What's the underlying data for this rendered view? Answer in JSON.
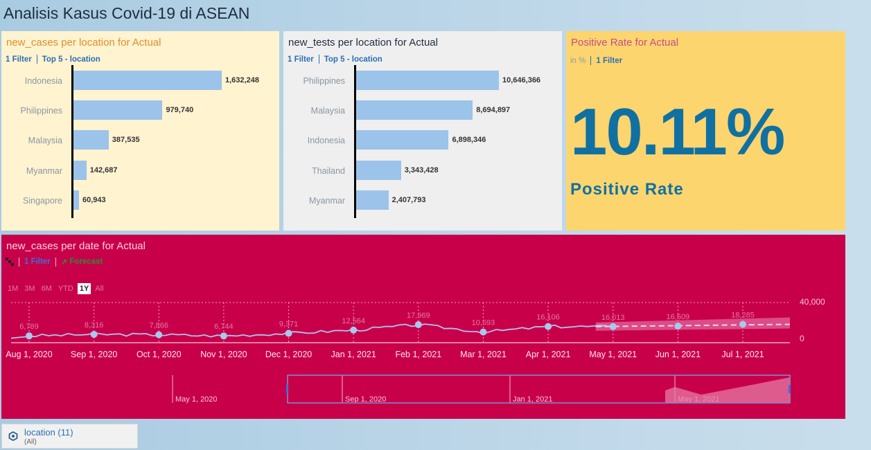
{
  "app": {
    "title": "Analisis Kasus Covid-19 di ASEAN"
  },
  "tile_cases": {
    "title": "new_cases per location for Actual",
    "filter": "1 Filter",
    "top": "Top 5 - location",
    "chart_data": {
      "type": "bar",
      "categories": [
        "Indonesia",
        "Philippines",
        "Malaysia",
        "Myanmar",
        "Singapore"
      ],
      "values": [
        1632248,
        979740,
        387535,
        142687,
        60943
      ],
      "value_labels": [
        "1,632,248",
        "979,740",
        "387,535",
        "142,687",
        "60,943"
      ]
    }
  },
  "tile_tests": {
    "title": "new_tests per location for Actual",
    "filter": "1 Filter",
    "top": "Top 5 - location",
    "chart_data": {
      "type": "bar",
      "categories": [
        "Philippines",
        "Malaysia",
        "Indonesia",
        "Thailand",
        "Myanmar"
      ],
      "values": [
        10646366,
        8694897,
        6898346,
        3343428,
        2407793
      ],
      "value_labels": [
        "10,646,366",
        "8,694,897",
        "6,898,346",
        "3,343,428",
        "2,407,793"
      ]
    }
  },
  "tile_rate": {
    "title": "Positive Rate for Actual",
    "unit": "in %",
    "filter": "1 Filter",
    "value": "10.11%",
    "label": "Positive Rate"
  },
  "tile_timeline": {
    "title": "new_cases per date for Actual",
    "filter": "1 Filter",
    "forecast": "Forecast",
    "range_buttons": [
      "1M",
      "3M",
      "6M",
      "YTD",
      "1Y",
      "All"
    ],
    "active_range": "1Y",
    "chart_data": {
      "type": "line",
      "x_labels": [
        "Aug 1, 2020",
        "Sep 1, 2020",
        "Oct 1, 2020",
        "Nov 1, 2020",
        "Dec 1, 2020",
        "Jan 1, 2021",
        "Feb 1, 2021",
        "Mar 1, 2021",
        "Apr 1, 2021",
        "May 1, 2021",
        "Jun 1, 2021",
        "Jul 1, 2021"
      ],
      "y_ticks": [
        "40,000",
        "0"
      ],
      "ylim": [
        0,
        40000
      ],
      "point_labels": [
        "6,789",
        "8,316",
        "7,866",
        "6,744",
        "9,371",
        "12,564",
        "17,969",
        "10,593",
        "16,106",
        "16,013",
        "16,509",
        "18,285"
      ],
      "point_values": [
        6789,
        8316,
        7866,
        6744,
        9371,
        12564,
        17969,
        10593,
        16106,
        16013,
        16509,
        18285
      ],
      "forecast_from_index": 9,
      "navigator_labels": [
        "May 1, 2020",
        "Sep 1, 2020",
        "Jan 1, 2021",
        "May 1, 2021"
      ]
    }
  },
  "filter_panel": {
    "title": "location (11)",
    "sub": "(All)"
  },
  "colors": {
    "bar": "#9cc3ea",
    "kpi": "#1170a2",
    "timeline_bg": "#c8004a"
  }
}
